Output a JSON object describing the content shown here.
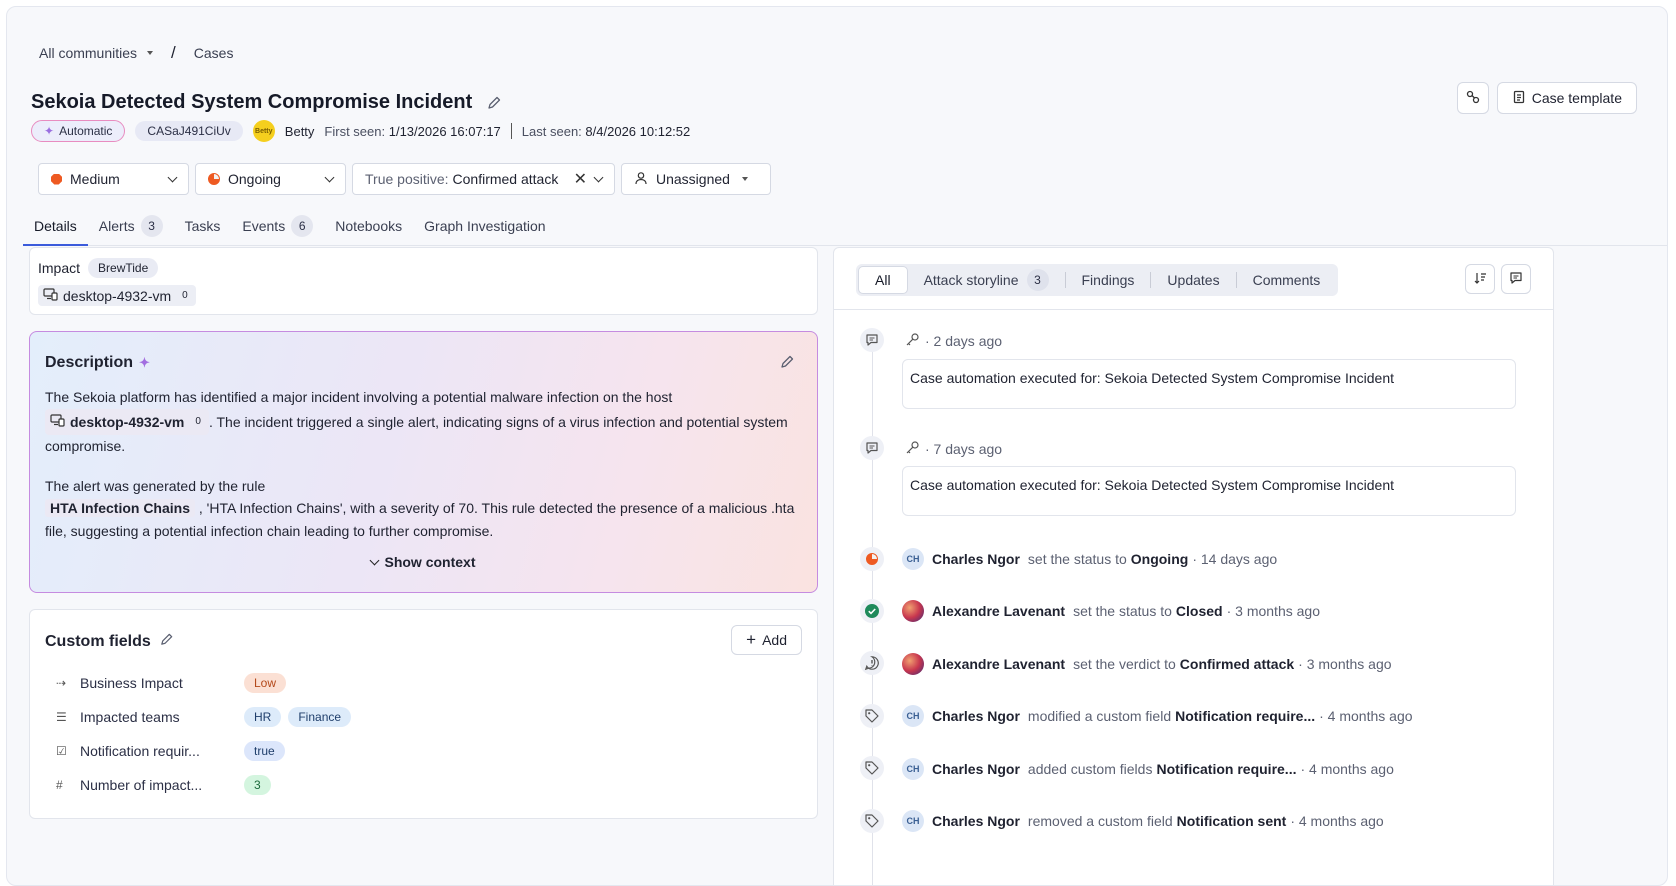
{
  "breadcrumb": {
    "community": "All communities",
    "separator": "/",
    "current": "Cases"
  },
  "case": {
    "title": "Sekoia Detected System Compromise Incident",
    "mode_badge": "Automatic",
    "case_id": "CASaJ491CiUv",
    "avatar_initials": "Betty",
    "owner": "Betty",
    "first_seen_label": "First seen:",
    "first_seen": "1/13/2026 16:07:17",
    "last_seen_label": "Last seen:",
    "last_seen": "8/4/2026 10:12:52"
  },
  "header_buttons": {
    "case_template": "Case template"
  },
  "filters": {
    "severity": "Medium",
    "status": "Ongoing",
    "verdict_prefix": "True positive:",
    "verdict": "Confirmed attack",
    "assignee": "Unassigned"
  },
  "tabs": [
    {
      "label": "Details",
      "count": null
    },
    {
      "label": "Alerts",
      "count": "3"
    },
    {
      "label": "Tasks",
      "count": null
    },
    {
      "label": "Events",
      "count": "6"
    },
    {
      "label": "Notebooks",
      "count": null
    },
    {
      "label": "Graph Investigation",
      "count": null
    }
  ],
  "impact": {
    "label": "Impact",
    "badge": "BrewTide",
    "host": "desktop-4932-vm",
    "host_count": "0"
  },
  "description": {
    "title": "Description",
    "p1_a": "The Sekoia platform has identified a major incident involving a potential malware infection on the host",
    "p1_host": "desktop-4932-vm",
    "p1_host_count": "0",
    "p1_b": ". The incident triggered a single alert, indicating signs of a virus infection and potential system compromise.",
    "p2_a": "The alert was generated by the rule",
    "p2_rule": "HTA Infection Chains",
    "p2_b": ", 'HTA Infection Chains', with a severity of 70. This rule detected the presence of a malicious .hta file, suggesting a potential infection chain leading to further compromise.",
    "show_context": "Show context"
  },
  "custom_fields": {
    "title": "Custom fields",
    "add_label": "Add",
    "rows": [
      {
        "label": "Business Impact",
        "icon": "⇢",
        "values": [
          "Low"
        ]
      },
      {
        "label": "Impacted teams",
        "icon": "☰",
        "values": [
          "HR",
          "Finance"
        ]
      },
      {
        "label": "Notification requir...",
        "icon": "☑",
        "values": [
          "true"
        ]
      },
      {
        "label": "Number of impact...",
        "icon": "#",
        "values": [
          "3"
        ]
      }
    ]
  },
  "activity": {
    "filters": [
      {
        "label": "All",
        "count": null
      },
      {
        "label": "Attack storyline",
        "count": "3"
      },
      {
        "label": "Findings",
        "count": null
      },
      {
        "label": "Updates",
        "count": null
      },
      {
        "label": "Comments",
        "count": null
      }
    ],
    "automations": [
      {
        "time": "· 2 days ago",
        "text": "Case automation executed for: Sekoia Detected System Compromise Incident"
      },
      {
        "time": "· 7 days ago",
        "text": "Case automation executed for: Sekoia Detected System Compromise Incident"
      }
    ],
    "events": [
      {
        "icon": "status-ongoing-icon",
        "avatar": "CH",
        "who": "Charles Ngor",
        "action": "set the status to",
        "target": "Ongoing",
        "time": "· 14 days ago"
      },
      {
        "icon": "status-closed-icon",
        "avatar": "",
        "who": "Alexandre Lavenant",
        "action": "set the status to",
        "target": "Closed",
        "time": "· 3 months ago"
      },
      {
        "icon": "verdict-icon",
        "avatar": "",
        "who": "Alexandre Lavenant",
        "action": "set the verdict to",
        "target": "Confirmed attack",
        "time": "· 3 months ago"
      },
      {
        "icon": "tag-icon",
        "avatar": "CH",
        "who": "Charles Ngor",
        "action": "modified a custom field",
        "target": "Notification require...",
        "time": "· 4 months ago"
      },
      {
        "icon": "tag-icon",
        "avatar": "CH",
        "who": "Charles Ngor",
        "action": "added custom fields",
        "target": "Notification require...",
        "time": "· 4 months ago"
      },
      {
        "icon": "tag-icon",
        "avatar": "CH",
        "who": "Charles Ngor",
        "action": "removed a custom field",
        "target": "Notification sent",
        "time": "· 4 months ago"
      }
    ]
  },
  "colors": {
    "accent": "#3b5bdb",
    "severity_medium": "#ee5a22",
    "closed": "#1f8a5b"
  }
}
